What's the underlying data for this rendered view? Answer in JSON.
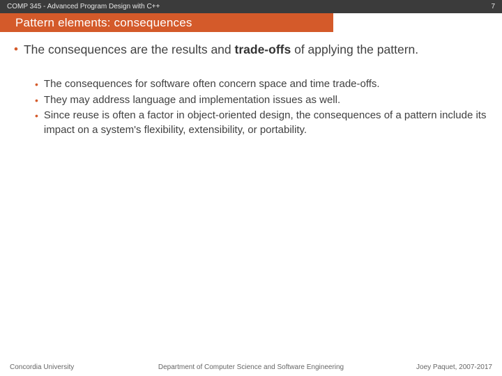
{
  "header": {
    "course": "COMP 345 - Advanced Program Design with C++",
    "page_number": "7"
  },
  "title": "Pattern elements: consequences",
  "main": {
    "pre": "The consequences are the results and ",
    "strong": "trade-offs",
    "post": " of applying the pattern."
  },
  "subs": [
    "The consequences for software often concern space and time trade-offs.",
    "They may address language and implementation issues as well.",
    "Since reuse is often a factor in object-oriented design, the consequences of a pattern include its impact on a system's flexibility, extensibility, or portability."
  ],
  "footer": {
    "left": "Concordia University",
    "center": "Department of Computer Science and Software Engineering",
    "right": "Joey Paquet, 2007-2017"
  }
}
